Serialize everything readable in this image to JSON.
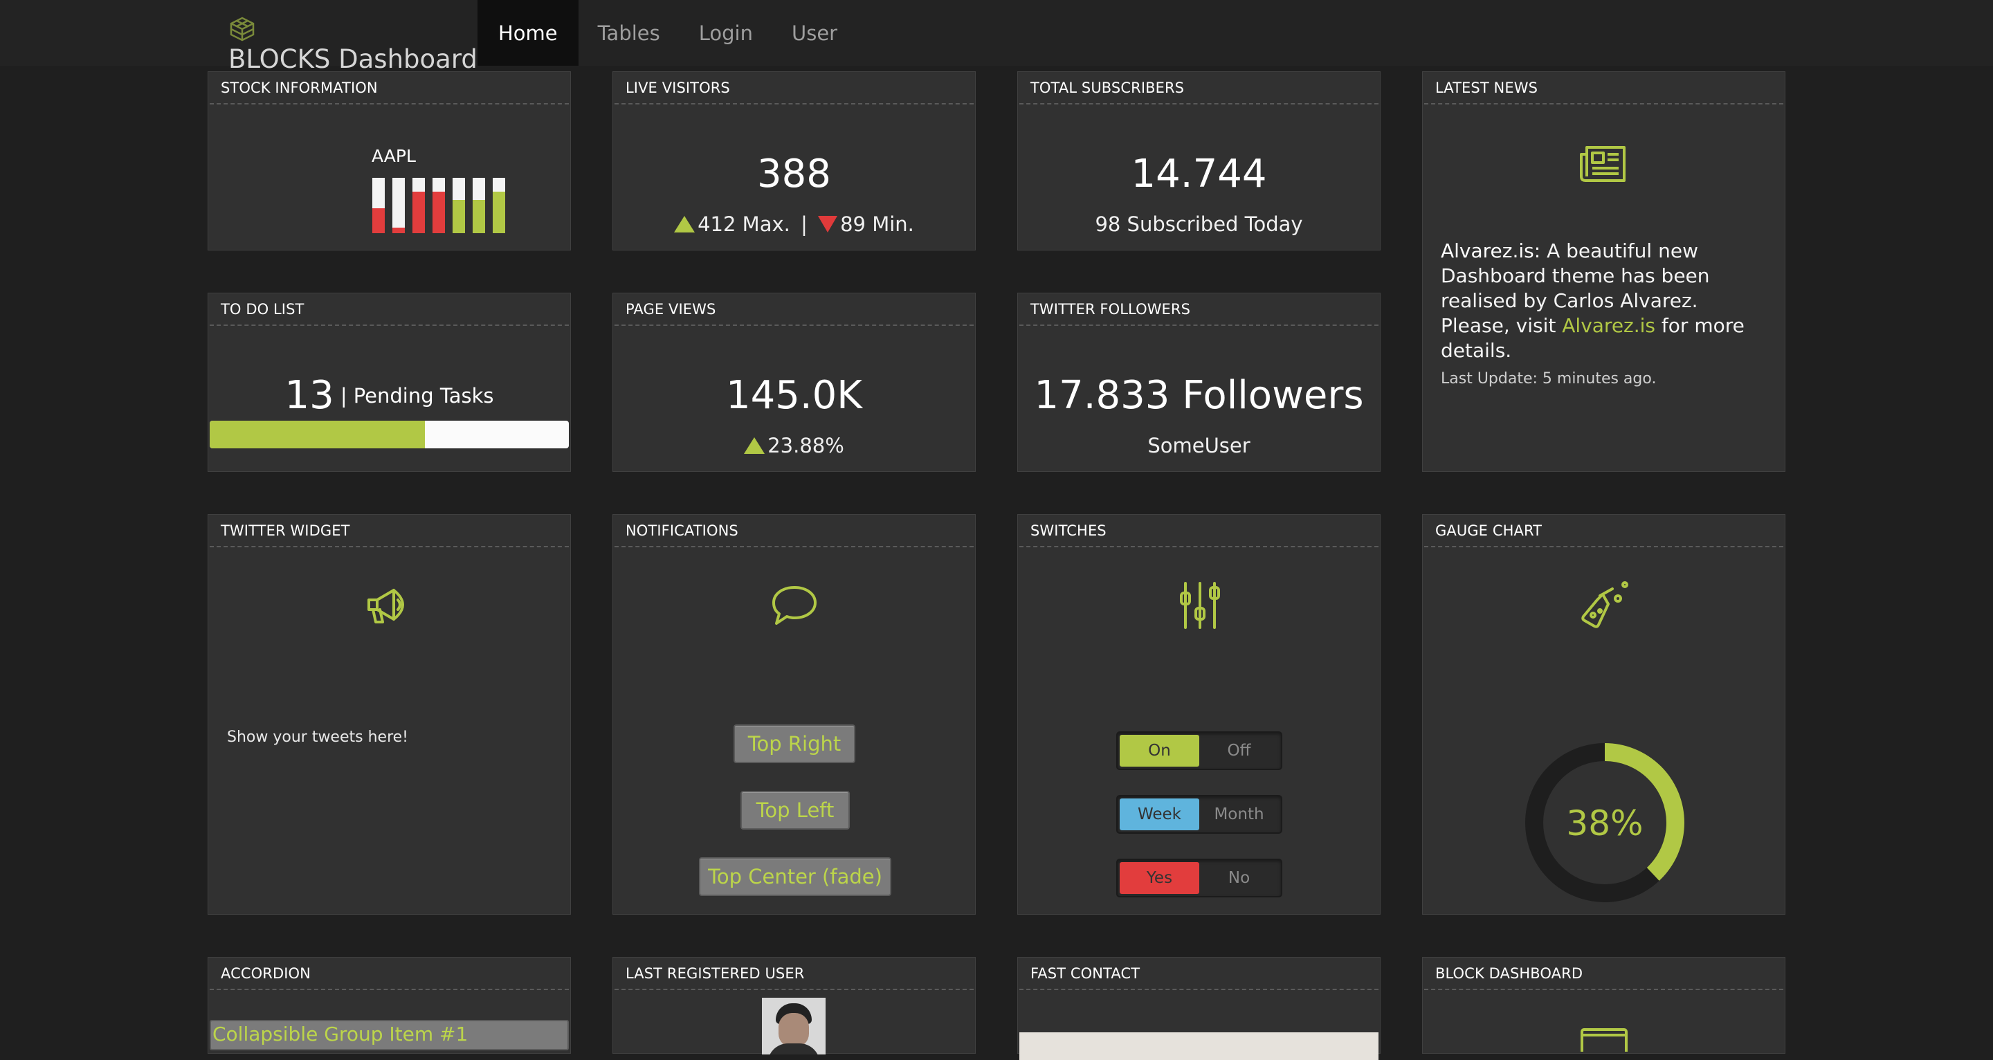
{
  "brand": {
    "title": "BLOCKS Dashboard"
  },
  "nav": [
    {
      "label": "Home",
      "active": true
    },
    {
      "label": "Tables"
    },
    {
      "label": "Login"
    },
    {
      "label": "User"
    }
  ],
  "stock": {
    "title": "STOCK INFORMATION",
    "symbol": "AAPL",
    "bars": [
      {
        "color": "red",
        "fill": 0.45
      },
      {
        "color": "red",
        "fill": 0.1
      },
      {
        "color": "red",
        "fill": 0.75
      },
      {
        "color": "red",
        "fill": 0.75
      },
      {
        "color": "green",
        "fill": 0.6
      },
      {
        "color": "green",
        "fill": 0.6
      },
      {
        "color": "green",
        "fill": 0.75
      }
    ]
  },
  "visitors": {
    "title": "LIVE VISITORS",
    "value": "388",
    "max": "412 Max.",
    "sep": "|",
    "min": "89 Min."
  },
  "subscribers": {
    "title": "TOTAL SUBSCRIBERS",
    "value": "14.744",
    "today": "98 Subscribed Today"
  },
  "news": {
    "title": "LATEST NEWS",
    "author": "Alvarez.is:",
    "body": "A beautiful new Dashboard theme has been realised by Carlos Alvarez. Please, visit",
    "link": "Alvarez.is",
    "tail": "for more details.",
    "updated": "Last Update: 5 minutes ago."
  },
  "todo": {
    "title": "TO DO LIST",
    "count": "13",
    "sep": "|",
    "label": "Pending Tasks",
    "progress": 0.6
  },
  "pageviews": {
    "title": "PAGE VIEWS",
    "value": "145.0K",
    "change": "23.88%"
  },
  "twitter_followers": {
    "title": "TWITTER FOLLOWERS",
    "value": "17.833 Followers",
    "user": "SomeUser"
  },
  "twitter_widget": {
    "title": "TWITTER WIDGET",
    "text": "Show your tweets here!"
  },
  "notifications": {
    "title": "NOTIFICATIONS",
    "buttons": [
      "Top Right",
      "Top Left",
      "Top Center (fade)"
    ]
  },
  "switches": {
    "title": "SWITCHES",
    "items": [
      {
        "on": "On",
        "off": "Off",
        "color": "#b1c845"
      },
      {
        "on": "Week",
        "off": "Month",
        "color": "#5fb4dd"
      },
      {
        "on": "Yes",
        "off": "No",
        "color": "#e23d3d"
      }
    ]
  },
  "gauge": {
    "title": "GAUGE CHART",
    "value": "38%",
    "fraction": 0.38,
    "color": "#b1c845",
    "track": "#1e1e1e"
  },
  "accordion": {
    "title": "ACCORDION",
    "item1": "Collapsible Group Item #1"
  },
  "last_user": {
    "title": "LAST REGISTERED USER"
  },
  "contact": {
    "title": "FAST CONTACT"
  },
  "block_dashboard": {
    "title": "BLOCK DASHBOARD"
  },
  "colors": {
    "accent": "#b1c845",
    "red": "#e23d3d",
    "blue": "#5fb4dd",
    "card": "#313131",
    "bg": "#1f1f1f"
  }
}
